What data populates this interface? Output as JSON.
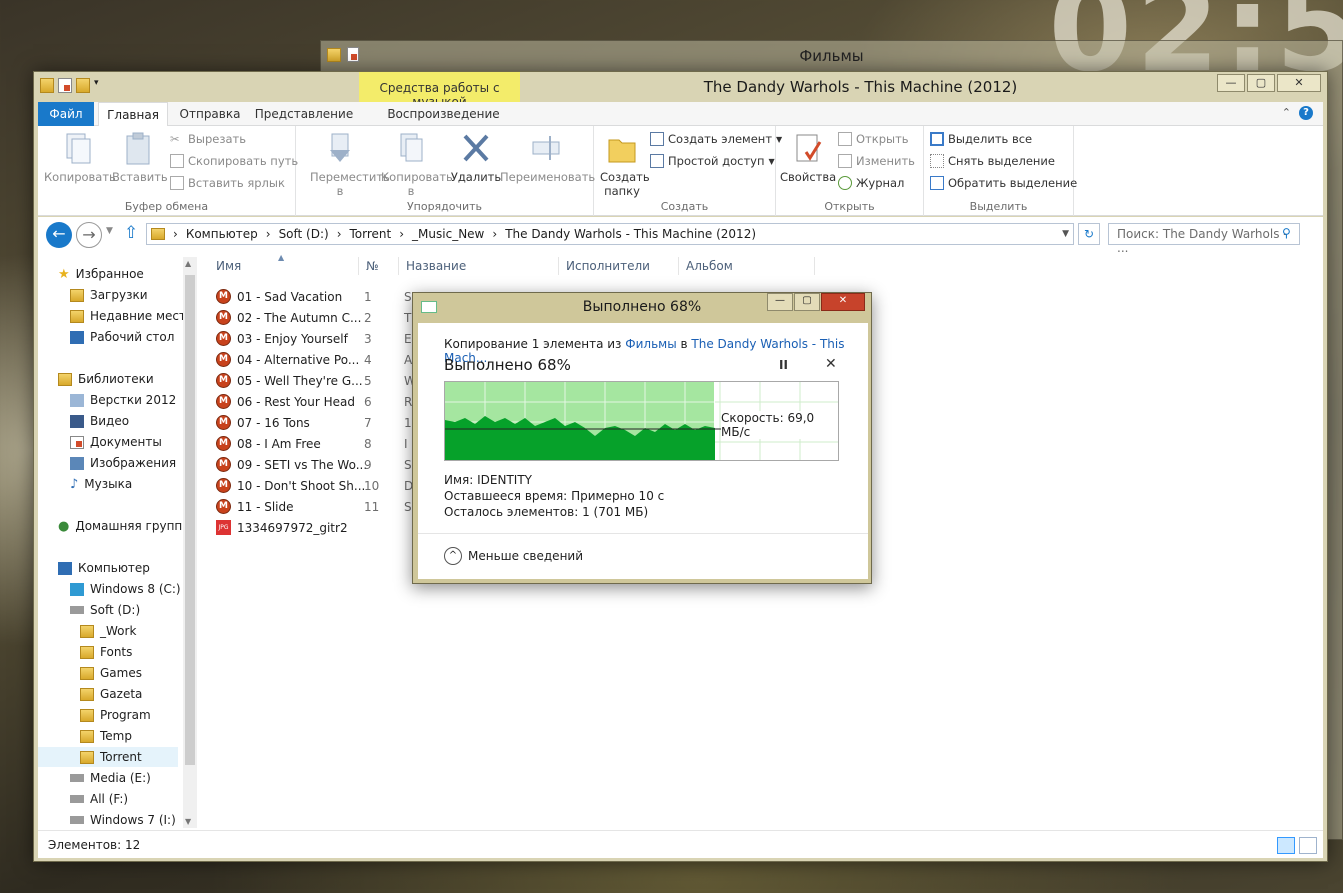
{
  "clock": "02:5",
  "bg_window": {
    "title": "Фильмы"
  },
  "window": {
    "title": "The Dandy Warhols - This Machine (2012)",
    "context_tab_group": "Средства работы с музыкой",
    "buttons": {
      "minimize": "—",
      "maximize": "▢",
      "close": "✕"
    }
  },
  "tabs": {
    "file": "Файл",
    "home": "Главная",
    "share": "Отправка",
    "view": "Представление",
    "playback": "Воспроизведение"
  },
  "ribbon": {
    "clipboard": {
      "label": "Буфер обмена",
      "copy": "Копировать",
      "paste": "Вставить",
      "cut": "Вырезать",
      "copy_path": "Скопировать путь",
      "paste_shortcut": "Вставить ярлык"
    },
    "organize": {
      "label": "Упорядочить",
      "move_to": "Переместить в",
      "copy_to": "Копировать в",
      "delete": "Удалить",
      "rename": "Переименовать"
    },
    "create": {
      "label": "Создать",
      "new_folder": "Создать папку",
      "new_item": "Создать элемент",
      "easy_access": "Простой доступ"
    },
    "open": {
      "label": "Открыть",
      "properties": "Свойства",
      "open": "Открыть",
      "edit": "Изменить",
      "history": "Журнал"
    },
    "select": {
      "label": "Выделить",
      "select_all": "Выделить все",
      "select_none": "Снять выделение",
      "invert": "Обратить выделение"
    }
  },
  "address": {
    "crumbs": [
      "Компьютер",
      "Soft (D:)",
      "Torrent",
      "_Music_New",
      "The Dandy Warhols - This Machine (2012)"
    ],
    "search_placeholder": "Поиск: The Dandy Warhols - ..."
  },
  "nav": {
    "favorites": "Избранное",
    "downloads": "Загрузки",
    "recent": "Недавние места",
    "desktop": "Рабочий стол",
    "libraries": "Библиотеки",
    "lib1": "Верстки 2012",
    "videos": "Видео",
    "documents": "Документы",
    "images": "Изображения",
    "music": "Музыка",
    "homegroup": "Домашняя группа",
    "computer": "Компьютер",
    "drive_c": "Windows 8 (C:)",
    "drive_d": "Soft (D:)",
    "work": "_Work",
    "fonts": "Fonts",
    "games": "Games",
    "gazeta": "Gazeta",
    "program": "Program",
    "temp": "Temp",
    "torrent": "Torrent",
    "drive_e": "Media (E:)",
    "drive_f": "All (F:)",
    "drive_i": "Windows 7 (I:)"
  },
  "columns": {
    "name": "Имя",
    "num": "№",
    "title": "Название",
    "artists": "Исполнители",
    "album": "Альбом"
  },
  "files": [
    {
      "name": "01 - Sad Vacation",
      "num": "1",
      "art": "S"
    },
    {
      "name": "02 - The Autumn C...",
      "num": "2",
      "art": "T"
    },
    {
      "name": "03 - Enjoy Yourself",
      "num": "3",
      "art": "E"
    },
    {
      "name": "04 - Alternative Po...",
      "num": "4",
      "art": "A"
    },
    {
      "name": "05 - Well They're G...",
      "num": "5",
      "art": "W"
    },
    {
      "name": "06 - Rest Your Head",
      "num": "6",
      "art": "R"
    },
    {
      "name": "07 - 16 Tons",
      "num": "7",
      "art": "1"
    },
    {
      "name": "08 - I Am Free",
      "num": "8",
      "art": "I"
    },
    {
      "name": "09 - SETI vs The Wo...",
      "num": "9",
      "art": "S"
    },
    {
      "name": "10 - Don't Shoot Sh...",
      "num": "10",
      "art": "D"
    },
    {
      "name": "11 - Slide",
      "num": "11",
      "art": "S"
    },
    {
      "name": "1334697972_gitr2",
      "num": "",
      "art": ""
    }
  ],
  "file_icon_mark": "M",
  "jpg_mark": "JPG",
  "status": {
    "items": "Элементов: 12"
  },
  "dialog": {
    "title": "Выполнено 68%",
    "copying_prefix": "Копирование 1 элемента из",
    "from": "Фильмы",
    "in_word": "в",
    "to": "The Dandy Warhols - This Mach...",
    "percent_text": "Выполнено 68%",
    "progress": 0.68,
    "speed": "Скорость: 69,0 МБ/с",
    "name_label": "Имя:",
    "name_value": "IDENTITY",
    "time_label": "Оставшееся время:",
    "time_value": "Примерно 10 с",
    "items_label": "Осталось элементов:",
    "items_value": "1 (701 МБ)",
    "less_details": "Меньше сведений",
    "pause_glyph": "II",
    "close_glyph": "✕"
  },
  "colors": {
    "accent": "#1979ca",
    "progress_fill": "#06a12a",
    "progress_bg": "#a5e6a0",
    "link": "#1a5fb4"
  }
}
